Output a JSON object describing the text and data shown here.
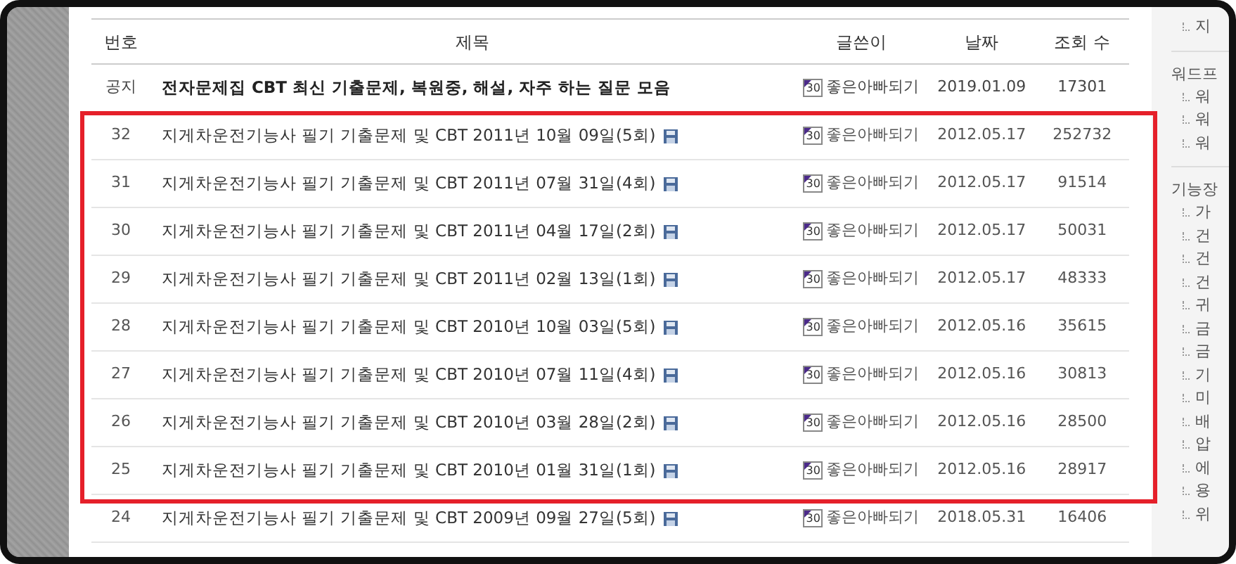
{
  "table": {
    "columns": [
      "번호",
      "제목",
      "글쓴이",
      "날짜",
      "조회 수"
    ],
    "rows": [
      {
        "kind": "notice",
        "number": "공지",
        "title": "전자문제집 CBT 최신 기출문제, 복원중, 해설, 자주 하는 질문 모음",
        "level_badge": "30",
        "author": "좋은아빠되기",
        "date": "2019.01.09",
        "views": "17301"
      },
      {
        "kind": "post",
        "number": "32",
        "title": "지게차운전기능사 필기 기출문제 및 CBT 2011년 10월 09일(5회)",
        "level_badge": "30",
        "author": "좋은아빠되기",
        "date": "2012.05.17",
        "views": "252732"
      },
      {
        "kind": "post",
        "number": "31",
        "title": "지게차운전기능사 필기 기출문제 및 CBT 2011년 07월 31일(4회)",
        "level_badge": "30",
        "author": "좋은아빠되기",
        "date": "2012.05.17",
        "views": "91514"
      },
      {
        "kind": "post",
        "number": "30",
        "title": "지게차운전기능사 필기 기출문제 및 CBT 2011년 04월 17일(2회)",
        "level_badge": "30",
        "author": "좋은아빠되기",
        "date": "2012.05.17",
        "views": "50031"
      },
      {
        "kind": "post",
        "number": "29",
        "title": "지게차운전기능사 필기 기출문제 및 CBT 2011년 02월 13일(1회)",
        "level_badge": "30",
        "author": "좋은아빠되기",
        "date": "2012.05.17",
        "views": "48333"
      },
      {
        "kind": "post",
        "number": "28",
        "title": "지게차운전기능사 필기 기출문제 및 CBT 2010년 10월 03일(5회)",
        "level_badge": "30",
        "author": "좋은아빠되기",
        "date": "2012.05.16",
        "views": "35615"
      },
      {
        "kind": "post",
        "number": "27",
        "title": "지게차운전기능사 필기 기출문제 및 CBT 2010년 07월 11일(4회)",
        "level_badge": "30",
        "author": "좋은아빠되기",
        "date": "2012.05.16",
        "views": "30813"
      },
      {
        "kind": "post",
        "number": "26",
        "title": "지게차운전기능사 필기 기출문제 및 CBT 2010년 03월 28일(2회)",
        "level_badge": "30",
        "author": "좋은아빠되기",
        "date": "2012.05.16",
        "views": "28500"
      },
      {
        "kind": "post",
        "number": "25",
        "title": "지게차운전기능사 필기 기출문제 및 CBT 2010년 01월 31일(1회)",
        "level_badge": "30",
        "author": "좋은아빠되기",
        "date": "2012.05.16",
        "views": "28917"
      },
      {
        "kind": "post",
        "number": "24",
        "title": "지게차운전기능사 필기 기출문제 및 CBT 2009년 09월 27일(5회)",
        "level_badge": "30",
        "author": "좋은아빠되기",
        "date": "2018.05.31",
        "views": "16406"
      }
    ]
  },
  "sidebar": [
    {
      "kind": "item",
      "label": "지"
    },
    {
      "kind": "heading",
      "label": "워드프"
    },
    {
      "kind": "item",
      "label": "워"
    },
    {
      "kind": "item",
      "label": "워"
    },
    {
      "kind": "item",
      "label": "워"
    },
    {
      "kind": "heading",
      "label": "기능장"
    },
    {
      "kind": "item",
      "label": "가"
    },
    {
      "kind": "item",
      "label": "건"
    },
    {
      "kind": "item",
      "label": "건"
    },
    {
      "kind": "item",
      "label": "건"
    },
    {
      "kind": "item",
      "label": "귀"
    },
    {
      "kind": "item",
      "label": "금"
    },
    {
      "kind": "item",
      "label": "금"
    },
    {
      "kind": "item",
      "label": "기"
    },
    {
      "kind": "item",
      "label": "미"
    },
    {
      "kind": "item",
      "label": "배"
    },
    {
      "kind": "item",
      "label": "압"
    },
    {
      "kind": "item",
      "label": "에"
    },
    {
      "kind": "item",
      "label": "용"
    },
    {
      "kind": "item",
      "label": "위"
    }
  ]
}
